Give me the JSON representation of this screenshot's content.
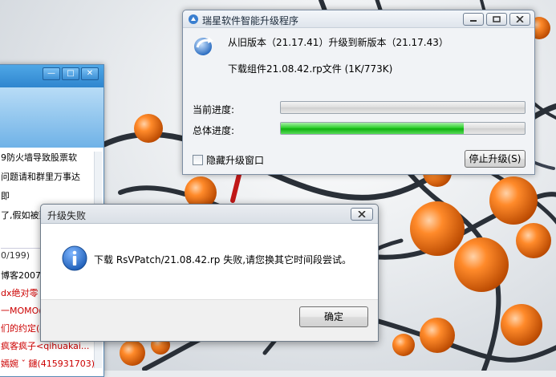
{
  "bg_window": {
    "messages": [
      "9防火墙导致股票软",
      "问题请和群里万事达",
      "即",
      "了,假如被到"
    ],
    "counter": "0/199)",
    "list": [
      {
        "text": "博客2007<",
        "red": false
      },
      {
        "text": "dx绝对零",
        "red": true
      },
      {
        "text": "一MOMO(",
        "red": true
      },
      {
        "text": "们的约定(4",
        "red": true
      },
      {
        "text": "疯客疯子<qihuakai...",
        "red": true
      },
      {
        "text": "嫣婉 ˇ 鑓(415931703)",
        "red": true
      }
    ]
  },
  "upgrade_window": {
    "title": "瑞星软件智能升级程序",
    "version_line": "从旧版本（21.17.41）升级到新版本（21.17.43）",
    "download_line": "下载组件21.08.42.rp文件 (1K/773K)",
    "current_label": "当前进度:",
    "total_label": "总体进度:",
    "current_progress": 0,
    "total_progress": 0.75,
    "hide_checkbox_label": "隐藏升级窗口",
    "stop_button": "停止升级(S)"
  },
  "error_dialog": {
    "title": "升级失败",
    "message": "下载 RsVPatch/21.08.42.rp 失败,请您换其它时间段尝试。",
    "ok_button": "确定"
  },
  "colors": {
    "progress_green": "#2fd02f",
    "info_blue": "#1f5fb8",
    "title_blue": "#2f86cf"
  }
}
